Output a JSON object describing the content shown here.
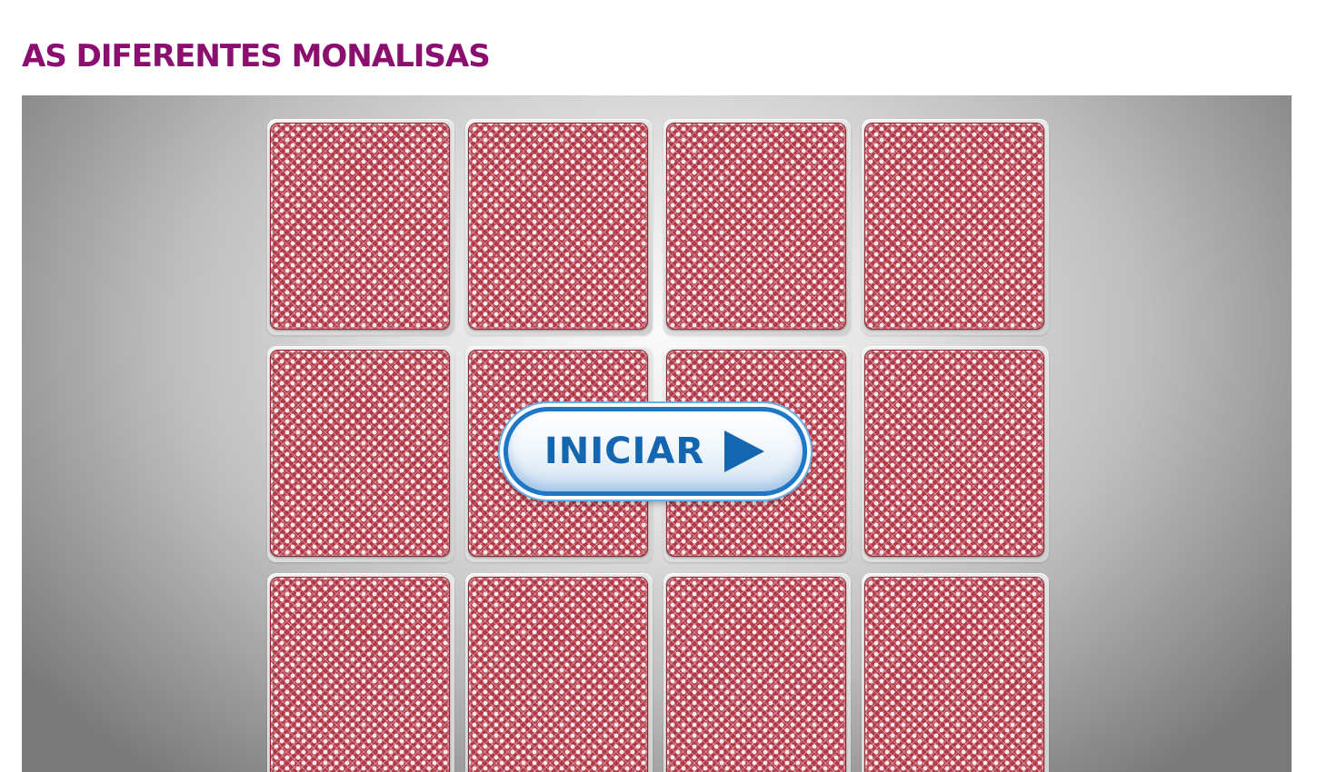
{
  "page": {
    "title": "AS DIFERENTES MONALISAS"
  },
  "game": {
    "type": "memory card game",
    "rows": 3,
    "columns": 4,
    "visible_cards": 12,
    "card_state": "face-down",
    "card_back_color": "#b33a48",
    "start_button": {
      "label": "INICIAR",
      "icon": "play-icon",
      "color": "#1466b0"
    }
  },
  "colors": {
    "title": "#8a0f6f",
    "button_border": "#1e78c8"
  }
}
